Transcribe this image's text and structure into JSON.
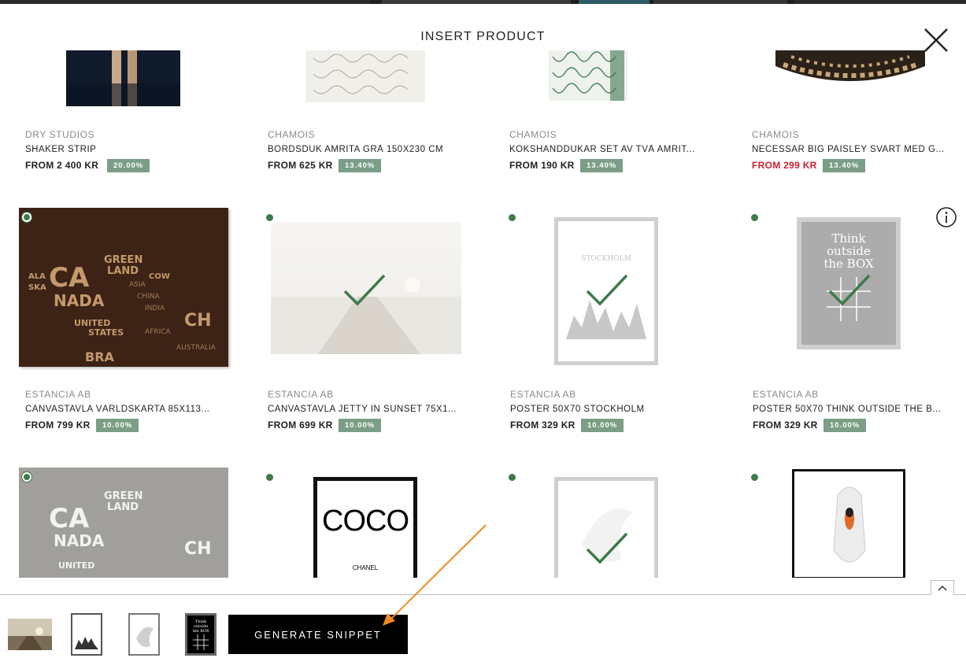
{
  "modal": {
    "title": "INSERT PRODUCT"
  },
  "products": [
    {
      "brand": "DRY STUDIOS",
      "name": "SHAKER STRIP",
      "price": "FROM 2 400 KR",
      "discount": "20.00%",
      "sale": false
    },
    {
      "brand": "CHAMOIS",
      "name": "BORDSDUK AMRITA GRÅ 150X230 CM",
      "price": "FROM 625 KR",
      "discount": "13.40%",
      "sale": false
    },
    {
      "brand": "CHAMOIS",
      "name": "KÖKSHANDDUKAR SET AV TVÅ AMRIT...",
      "price": "FROM 190 KR",
      "discount": "13.40%",
      "sale": false
    },
    {
      "brand": "CHAMOIS",
      "name": "NECESSÄR BIG PAISLEY SVART MED G...",
      "price": "FROM 299 KR",
      "discount": "13.40%",
      "sale": true
    },
    {
      "brand": "ESTANCIA AB",
      "name": "CANVASTAVLA VÄRLDSKARTA 85X113...",
      "price": "FROM 799 KR",
      "discount": "10.00%",
      "sale": false
    },
    {
      "brand": "ESTANCIA AB",
      "name": "CANVASTAVLA JETTY IN SUNSET 75X1...",
      "price": "FROM 699 KR",
      "discount": "10.00%",
      "sale": false
    },
    {
      "brand": "ESTANCIA AB",
      "name": "POSTER 50X70 STOCKHOLM",
      "price": "FROM 329 KR",
      "discount": "10.00%",
      "sale": false
    },
    {
      "brand": "ESTANCIA AB",
      "name": "POSTER 50X70 THINK OUTSIDE THE B...",
      "price": "FROM 329 KR",
      "discount": "10.00%",
      "sale": false
    }
  ],
  "artwork": {
    "map_words": [
      "CA",
      "NADA",
      "UNITED",
      "STATES",
      "GREEN",
      "LAND",
      "CH",
      "BRA",
      "ALA",
      "SKA",
      "COW"
    ],
    "stockholm": "STOCKHOLM",
    "think": [
      "Think",
      "outside",
      "the BOX"
    ],
    "coco": "COCO",
    "chanel": "CHANEL"
  },
  "footer": {
    "generate_label": "GENERATE SNIPPET"
  },
  "colors": {
    "selected_dot": "#3f7a4a",
    "badge": "#7a9e86",
    "sale_price": "#c8202f",
    "check": "#3f7a4a",
    "arrow": "#f08a24"
  }
}
